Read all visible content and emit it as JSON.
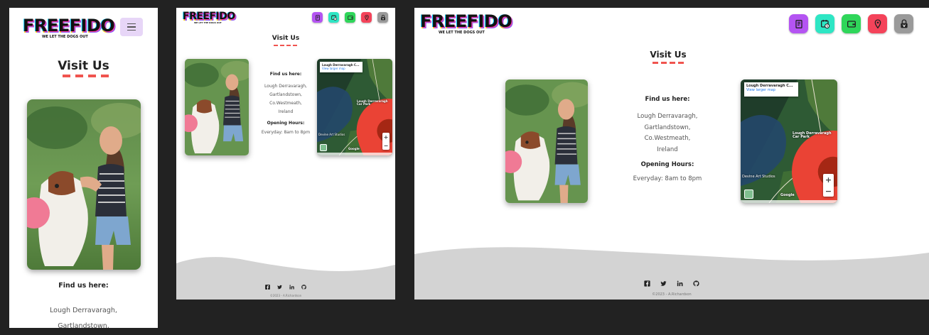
{
  "brand": {
    "name": "FREEFIDO",
    "tagline": "WE LET THE DOGS OUT"
  },
  "page": {
    "heading": "Visit Us"
  },
  "find_us": {
    "title": "Find us here:",
    "address_lines": [
      "Lough Derravaragh,",
      "Gartlandstown,",
      "Co.Westmeath,",
      "Ireland"
    ],
    "hours_title": "Opening Hours:",
    "hours": "Everyday: 8am to 8pm"
  },
  "map": {
    "place_title": "Lough Derravaragh C...",
    "view_larger": "View larger map",
    "pin_label_line1": "Lough Derravaragh",
    "pin_label_line2": "Car Park",
    "nearby_label": "Devine Art Studios",
    "zoom_in": "+",
    "zoom_out": "−",
    "attribution": "Google"
  },
  "nav": {
    "icons": [
      "book-icon",
      "calendar-clock-icon",
      "wallet-icon",
      "map-pin-icon",
      "lock-paw-icon"
    ],
    "colors": [
      "#b454f2",
      "#2ee6c4",
      "#2fd65a",
      "#f4435a",
      "#9a9a9a"
    ]
  },
  "footer": {
    "social": [
      "facebook-icon",
      "twitter-icon",
      "linkedin-icon",
      "github-icon"
    ],
    "copyright": "©2023 - A.Richardson"
  },
  "colors": {
    "accent": "#f0544f",
    "wave": "#d3d3d3",
    "menu": "#e7d6f7"
  }
}
